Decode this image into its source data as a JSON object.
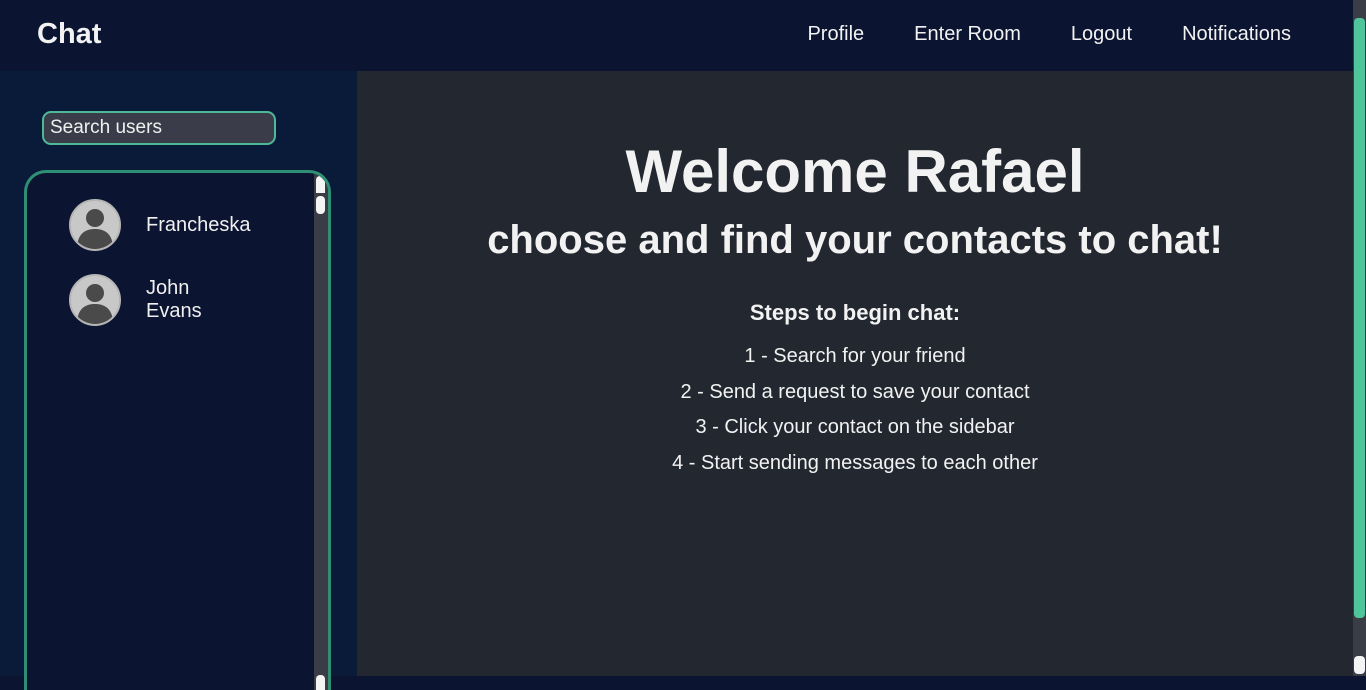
{
  "navbar": {
    "brand": "Chat",
    "links": [
      "Profile",
      "Enter Room",
      "Logout",
      "Notifications"
    ]
  },
  "sidebar": {
    "search": {
      "placeholder": "Search users",
      "value": ""
    },
    "contacts": [
      {
        "name": "Francheska",
        "avatar_icon": "user-silhouette-icon"
      },
      {
        "name_line1": "John",
        "name_line2": "Evans",
        "avatar_icon": "user-silhouette-icon"
      }
    ]
  },
  "main": {
    "welcome": "Welcome Rafael",
    "subtitle": "choose and find your contacts to chat!",
    "steps_title": "Steps to begin chat:",
    "steps": [
      "1 - Search for your friend",
      "2 - Send a request to save your contact",
      "3 - Click your contact on the sidebar",
      "4 - Start sending messages to each other"
    ]
  },
  "colors": {
    "navbar_bg": "#0b1430",
    "sidebar_bg": "#091b38",
    "main_bg": "#232830",
    "accent": "#4fb89a",
    "text": "#f2f2f2"
  }
}
